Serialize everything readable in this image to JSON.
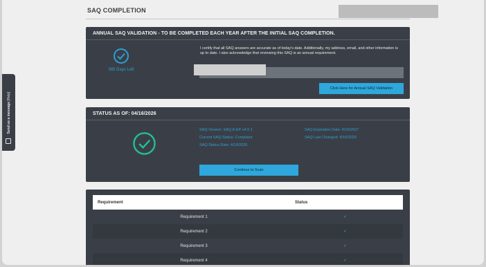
{
  "page": {
    "title": "SAQ COMPLETION"
  },
  "annual": {
    "heading": "ANNUAL SAQ VALIDATION - TO BE COMPLETED EACH YEAR AFTER THE INITIAL SAQ COMPLETION.",
    "days_left": "365 Days Left",
    "certify_text": "I certify that all SAQ answers are accurate as of today's date. Additionally, my address, email, and other information is up to date. I also acknowledge that reviewing this SAQ is an annual requirement.",
    "button_label": "Click Here for Annual SAQ Validation"
  },
  "status": {
    "heading": "STATUS AS OF: 04/16/2026",
    "left_lines": [
      "SAQ Version: SAQ A-EP v4.0.1",
      "Current SAQ Status: Compliant",
      "SAQ Status Date: 4/16/2026"
    ],
    "right_lines": [
      "SAQ Expiration Date: 4/16/2027",
      "SAQ Last Changed: 4/16/2026"
    ],
    "button_label": "Continue to Scan"
  },
  "requirements": {
    "columns": [
      "Requirement",
      "Status"
    ],
    "rows": [
      {
        "name": "Requirement 1",
        "status_icon": "check-icon"
      },
      {
        "name": "Requirement 2",
        "status_icon": "check-icon"
      },
      {
        "name": "Requirement 3",
        "status_icon": "check-icon"
      },
      {
        "name": "Requirement 4",
        "status_icon": "check-icon"
      }
    ]
  },
  "side_tab": {
    "bold": "Send us a message",
    "light": "[Help]"
  },
  "colors": {
    "accent": "#2ea8dc",
    "panel": "#3a3f47",
    "check": "#22c08f",
    "info": "#2d9fd6"
  }
}
